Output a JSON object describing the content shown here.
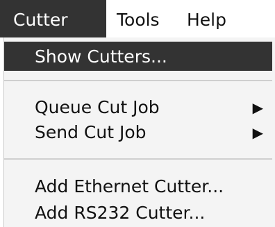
{
  "menubar": {
    "items": [
      {
        "label": "Cutter",
        "active": true
      },
      {
        "label": "Tools",
        "active": false
      },
      {
        "label": "Help",
        "active": false
      }
    ]
  },
  "dropdown": {
    "items": [
      {
        "label": "Show Cutters...",
        "highlighted": true,
        "submenu": false
      },
      {
        "label": "Queue Cut Job",
        "highlighted": false,
        "submenu": true
      },
      {
        "label": "Send Cut Job",
        "highlighted": false,
        "submenu": true
      },
      {
        "label": "Add Ethernet Cutter...",
        "highlighted": false,
        "submenu": false
      },
      {
        "label": "Add RS232 Cutter...",
        "highlighted": false,
        "submenu": false
      }
    ],
    "submenu_arrow": "▶"
  },
  "colors": {
    "highlight_bg": "#333333",
    "menu_bg": "#f4f4f4",
    "separator": "#cfcfcf"
  },
  "icons": {
    "submenu": "submenu-arrow-icon"
  }
}
